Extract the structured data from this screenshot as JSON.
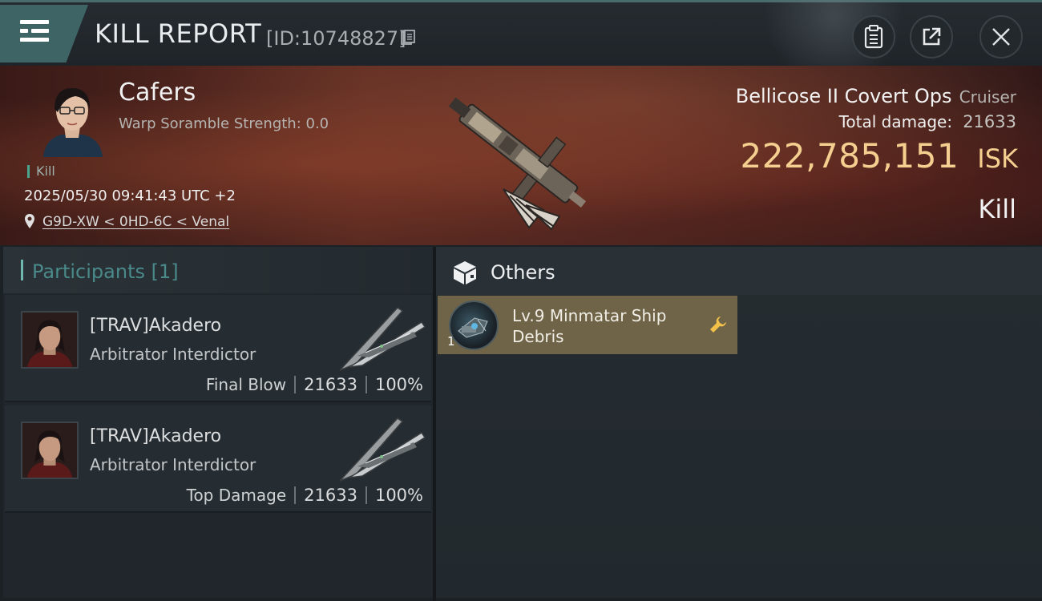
{
  "header": {
    "title": "KILL REPORT",
    "report_id": "[ID:10748827]"
  },
  "victim": {
    "name": "Cafers",
    "warp_scramble": "Warp Soramble Strength: 0.0",
    "kill_tag": "Kill",
    "datetime": "2025/05/30 09:41:43 UTC +2",
    "location": "G9D-XW < 0HD-6C < Venal",
    "ship_name": "Bellicose II Covert Ops",
    "ship_class": "Cruiser",
    "total_damage_label": "Total damage:",
    "total_damage_value": "21633",
    "isk_value": "222,785,151",
    "isk_unit": "ISK",
    "result": "Kill"
  },
  "participants": {
    "title": "Participants [1]",
    "rows": [
      {
        "name": "[TRAV]Akadero",
        "ship": "Arbitrator Interdictor",
        "role": "Final Blow",
        "damage": "21633",
        "percent": "100%"
      },
      {
        "name": "[TRAV]Akadero",
        "ship": "Arbitrator Interdictor",
        "role": "Top Damage",
        "damage": "21633",
        "percent": "100%"
      }
    ]
  },
  "others": {
    "title": "Others",
    "items": [
      {
        "name": "Lv.9 Minmatar Ship Debris",
        "quantity": "1"
      }
    ]
  },
  "icons": {
    "menu": "menu-icon",
    "copy": "copy-icon",
    "clipboard": "clipboard-icon",
    "share": "share-icon",
    "close": "close-icon",
    "location": "location-pin-icon",
    "box": "box-icon",
    "wrench": "wrench-icon"
  },
  "colors": {
    "accent_teal": "#3e6466",
    "isk_gold": "#f5cf8f",
    "item_bg": "#6f6448",
    "kill_tag": "#49a58f"
  }
}
